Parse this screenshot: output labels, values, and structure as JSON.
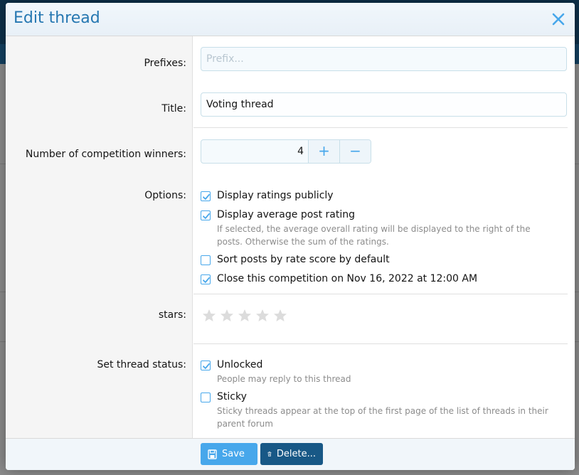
{
  "dialog": {
    "title": "Edit thread",
    "close_icon": "close-icon"
  },
  "fields": {
    "prefixes": {
      "label": "Prefixes:",
      "placeholder": "Prefix..."
    },
    "title": {
      "label": "Title:",
      "value": "Voting thread"
    },
    "winners": {
      "label": "Number of competition winners:",
      "value": "4",
      "increment": "+",
      "decrement": "−"
    },
    "options": {
      "label": "Options:",
      "items": [
        {
          "label": "Display ratings publicly",
          "checked": true
        },
        {
          "label": "Display average post rating",
          "checked": true,
          "hint": "If selected, the average overall rating will be displayed to the right of the posts. Otherwise the sum of the ratings."
        },
        {
          "label": "Sort posts by rate score by default",
          "checked": false
        },
        {
          "label": "Close this competition on Nov 16, 2022 at 12:00 AM",
          "checked": true
        }
      ]
    },
    "stars": {
      "label": "stars:",
      "count": 5,
      "rating": 0
    },
    "status": {
      "label": "Set thread status:",
      "items": [
        {
          "label": "Unlocked",
          "checked": true,
          "hint": "People may reply to this thread"
        },
        {
          "label": "Sticky",
          "checked": false,
          "hint": "Sticky threads appear at the top of the first page of the list of threads in their parent forum"
        }
      ]
    }
  },
  "footer": {
    "save_label": "Save",
    "delete_label": "Delete..."
  },
  "colors": {
    "accent": "#47a7eb",
    "title": "#2577b1",
    "delete_button": "#185886",
    "star_empty": "#dcdcdc"
  }
}
